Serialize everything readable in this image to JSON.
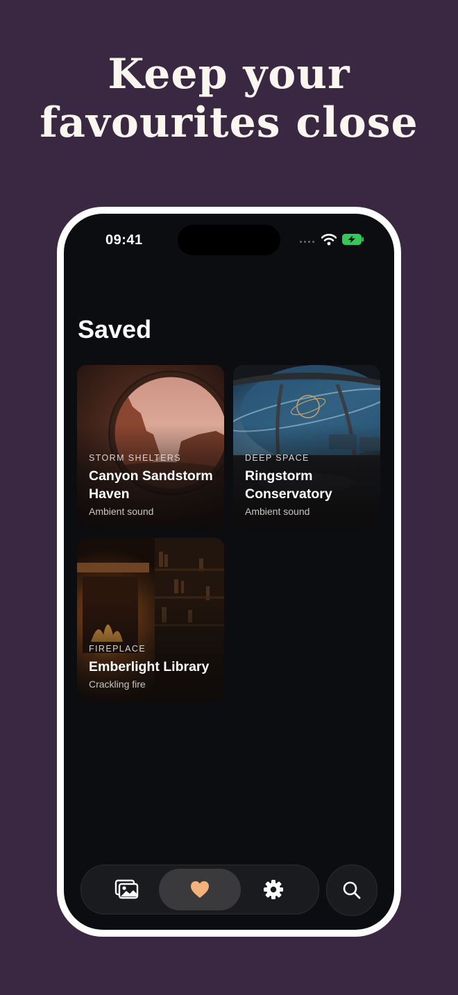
{
  "headline": {
    "line1": "Keep your",
    "line2": "favourites close"
  },
  "status_bar": {
    "time": "09:41",
    "icons": [
      "cellular-signal-icon",
      "wifi-icon",
      "battery-charging-icon"
    ]
  },
  "page": {
    "title": "Saved"
  },
  "cards": [
    {
      "category": "STORM SHELTERS",
      "title": "Canyon Sandstorm Haven",
      "subtitle": "Ambient sound"
    },
    {
      "category": "DEEP SPACE",
      "title": "Ringstorm Conservatory",
      "subtitle": "Ambient sound"
    },
    {
      "category": "FIREPLACE",
      "title": "Emberlight Library",
      "subtitle": "Crackling fire"
    }
  ],
  "tab_bar": {
    "tabs": [
      {
        "icon": "gallery-icon",
        "active": false
      },
      {
        "icon": "heart-icon",
        "active": true
      },
      {
        "icon": "gear-icon",
        "active": false
      }
    ],
    "search_icon": "search-icon"
  },
  "colors": {
    "background": "#3a2742",
    "screen": "#0c0d10",
    "accent_heart": "#f3b27c",
    "battery_green": "#35c759"
  }
}
